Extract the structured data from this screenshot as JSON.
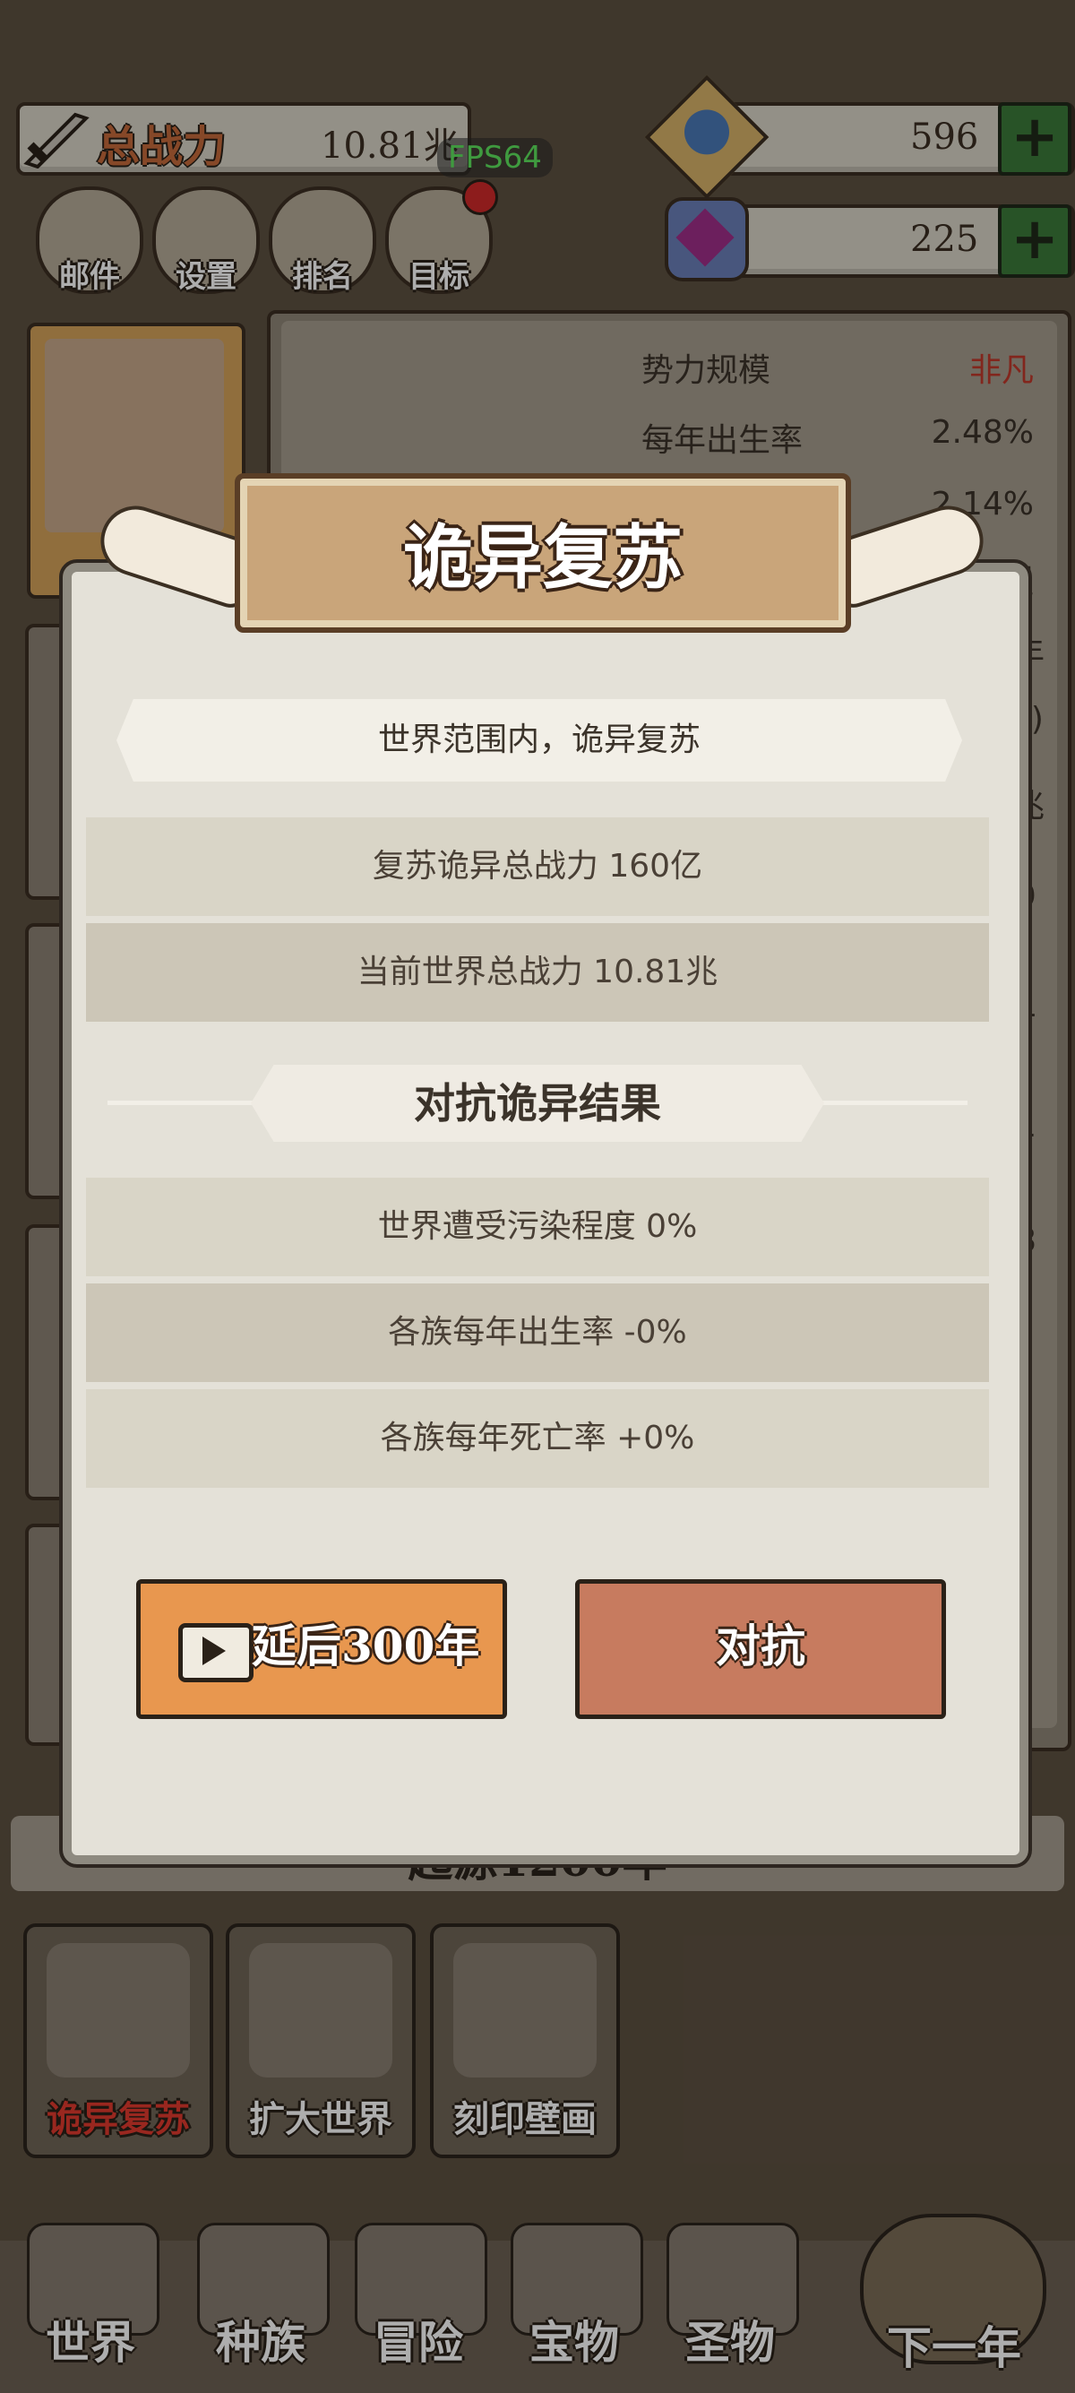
{
  "hud": {
    "power_label": "总战力",
    "power_value": "10.81兆",
    "fps": "FPS64",
    "currency1": "596",
    "currency2": "225"
  },
  "quick_menu": [
    {
      "label": "邮件"
    },
    {
      "label": "设置"
    },
    {
      "label": "排名"
    },
    {
      "label": "目标"
    }
  ],
  "side_panel": {
    "rows": [
      {
        "label": "势力规模",
        "value": "非凡",
        "value_color": "#c0392b"
      },
      {
        "label": "每年出生率",
        "value": "2.48%"
      },
      {
        "label": "",
        "value": "2.14%"
      }
    ],
    "partial": [
      "盟",
      "年",
      "0)",
      "兆",
      "9",
      "4",
      "1",
      "8"
    ]
  },
  "era_text": "起源1200年",
  "modal": {
    "title": "诡异复苏",
    "banner": "世界范围内，诡异复苏",
    "info_rows": [
      "复苏诡异总战力  160亿",
      "当前世界总战力  10.81兆"
    ],
    "section_title": "对抗诡异结果",
    "result_rows": [
      "世界遭受污染程度 0%",
      "各族每年出生率 -0%",
      "各族每年死亡率 +0%"
    ],
    "delay_button": "延后300年",
    "fight_button": "对抗"
  },
  "actions": [
    {
      "label": "诡异复苏",
      "color": "#e23a2e"
    },
    {
      "label": "扩大世界",
      "color": "#ffffff"
    },
    {
      "label": "刻印壁画",
      "color": "#ffffff"
    }
  ],
  "bottom_nav": [
    {
      "label": "世界"
    },
    {
      "label": "种族"
    },
    {
      "label": "冒险"
    },
    {
      "label": "宝物"
    },
    {
      "label": "圣物"
    },
    {
      "label": "下一年"
    }
  ]
}
